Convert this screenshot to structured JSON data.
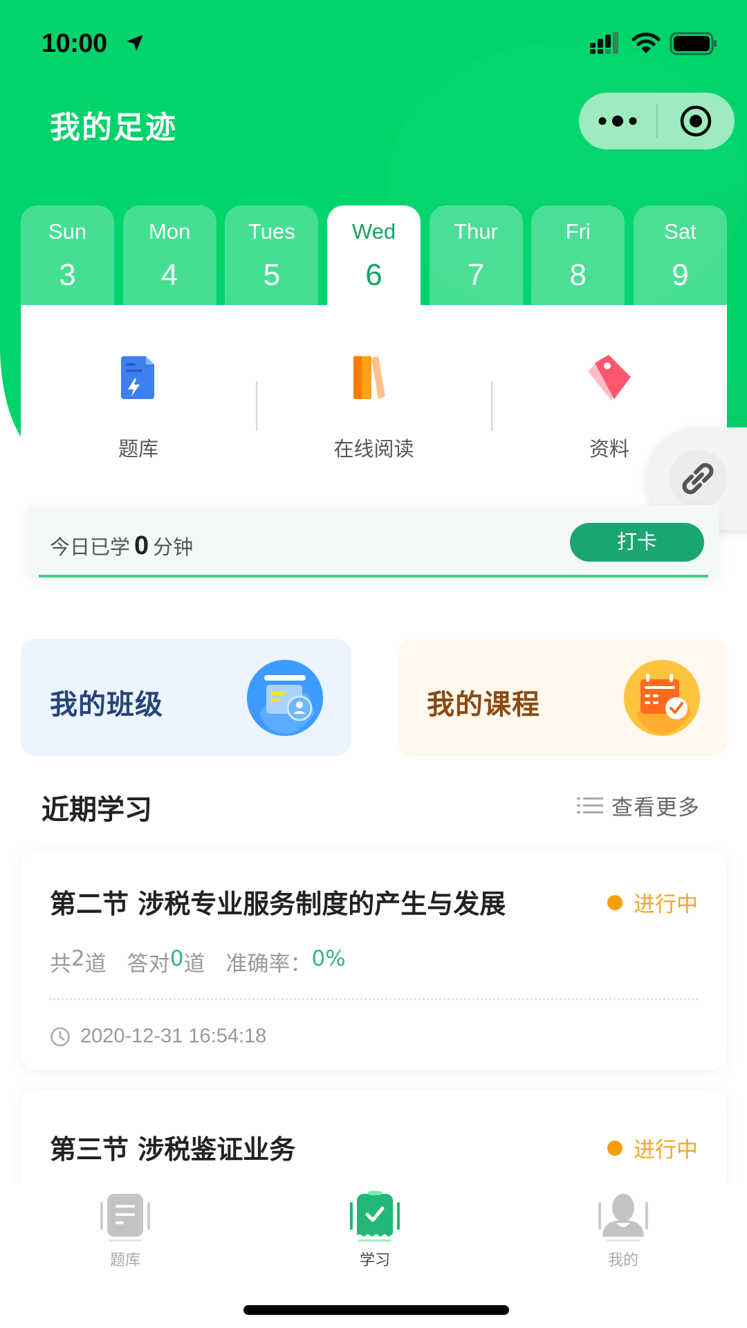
{
  "status_bar": {
    "time": "10:00",
    "location_icon": "location-arrow-icon",
    "signal_icon": "cellular-signal-icon",
    "wifi_icon": "wifi-icon",
    "battery_icon": "battery-icon"
  },
  "header": {
    "title": "我的足迹",
    "capsule": {
      "more_icon": "more-dots-icon",
      "close_icon": "target-close-icon"
    }
  },
  "week": {
    "days": [
      {
        "name": "Sun",
        "date": "3",
        "active": false
      },
      {
        "name": "Mon",
        "date": "4",
        "active": false
      },
      {
        "name": "Tues",
        "date": "5",
        "active": false
      },
      {
        "name": "Wed",
        "date": "6",
        "active": true
      },
      {
        "name": "Thur",
        "date": "7",
        "active": false
      },
      {
        "name": "Fri",
        "date": "8",
        "active": false
      },
      {
        "name": "Sat",
        "date": "9",
        "active": false
      }
    ]
  },
  "features": [
    {
      "label": "题库",
      "icon": "question-bank-doc-icon"
    },
    {
      "label": "在线阅读",
      "icon": "books-icon"
    },
    {
      "label": "资料",
      "icon": "tag-icon"
    }
  ],
  "float_button": {
    "icon": "link-icon"
  },
  "today_study": {
    "prefix": "今日已学",
    "minutes": "0",
    "suffix": "分钟",
    "checkin_label": "打卡"
  },
  "quick_cards": [
    {
      "label": "我的班级",
      "icon": "class-board-icon"
    },
    {
      "label": "我的课程",
      "icon": "course-calendar-icon"
    }
  ],
  "recent": {
    "title": "近期学习",
    "see_more": "查看更多",
    "records": [
      {
        "title": "第二节 涉税专业服务制度的产生与发展",
        "status": "进行中",
        "total_prefix": "共",
        "total": "2",
        "total_suffix": "道",
        "correct_prefix": "答对",
        "correct": "0",
        "correct_suffix": "道",
        "accuracy_label": "准确率：",
        "accuracy": "0%",
        "time": "2020-12-31 16:54:18"
      },
      {
        "title": "第三节 涉税鉴证业务",
        "status": "进行中"
      }
    ]
  },
  "tab_bar": {
    "items": [
      {
        "label": "题库",
        "active": false
      },
      {
        "label": "学习",
        "active": true
      },
      {
        "label": "我的",
        "active": false
      }
    ]
  },
  "colors": {
    "brand_green": "#00d46c",
    "accent_green": "#1aa573",
    "status_orange": "#f5a623"
  }
}
